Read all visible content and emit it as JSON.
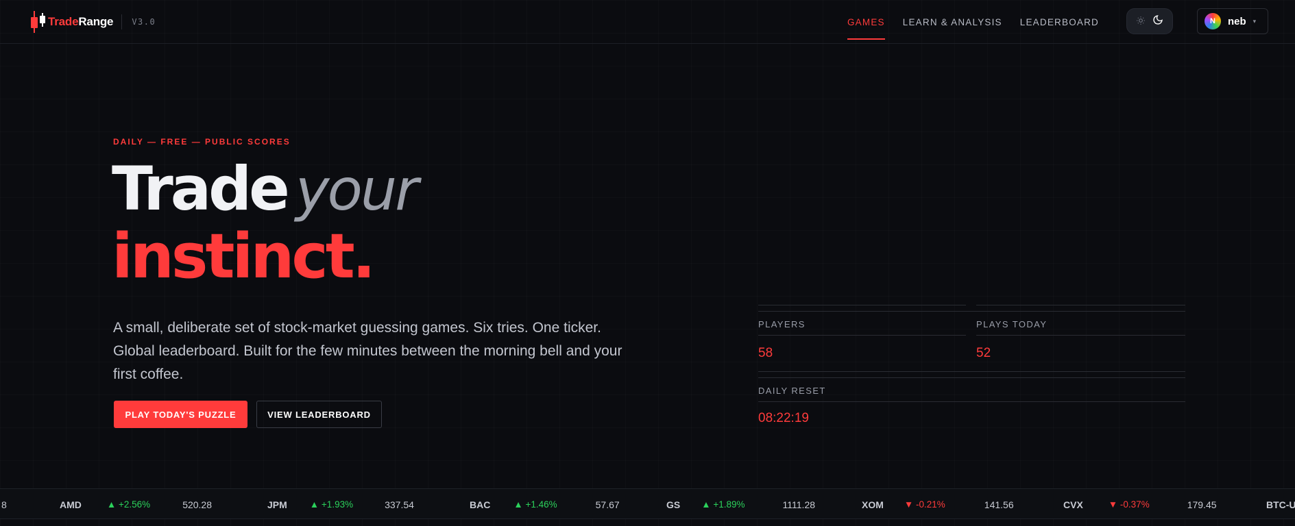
{
  "brand": {
    "name_red": "Trade",
    "name_white": "Range",
    "version": "V3.0"
  },
  "nav": {
    "items": [
      {
        "label": "GAMES",
        "active": true
      },
      {
        "label": "LEARN & ANALYSIS",
        "active": false
      },
      {
        "label": "LEADERBOARD",
        "active": false
      }
    ]
  },
  "user": {
    "name": "neb",
    "avatar_initial": "N"
  },
  "hero": {
    "eyebrow": "DAILY — FREE — PUBLIC SCORES",
    "headline_trade": "Trade",
    "headline_your": "your",
    "headline_instinct": "instinct.",
    "lede": "A small, deliberate set of stock-market guessing games. Six tries. One ticker. Global leaderboard. Built for the few minutes between the morning bell and your first coffee.",
    "primary_cta": "PLAY TODAY'S PUZZLE",
    "secondary_cta": "VIEW LEADERBOARD"
  },
  "stats": {
    "players_label": "PLAYERS",
    "players_value": "58",
    "plays_today_label": "PLAYS TODAY",
    "plays_today_value": "52",
    "daily_reset_label": "DAILY RESET",
    "daily_reset_value": "08:22:19"
  },
  "ticker": [
    {
      "symbol": "",
      "direction": "",
      "change": "",
      "price": "8"
    },
    {
      "symbol": "AMD",
      "direction": "up",
      "change": "+2.56%",
      "price": "520.28"
    },
    {
      "symbol": "JPM",
      "direction": "up",
      "change": "+1.93%",
      "price": "337.54"
    },
    {
      "symbol": "BAC",
      "direction": "up",
      "change": "+1.46%",
      "price": "57.67"
    },
    {
      "symbol": "GS",
      "direction": "up",
      "change": "+1.89%",
      "price": "1111.28"
    },
    {
      "symbol": "XOM",
      "direction": "down",
      "change": "-0.21%",
      "price": "141.56"
    },
    {
      "symbol": "CVX",
      "direction": "down",
      "change": "-0.37%",
      "price": "179.45"
    },
    {
      "symbol": "BTC-U",
      "direction": "",
      "change": "",
      "price": ""
    }
  ],
  "colors": {
    "accent": "#ff3b3b",
    "background": "#0b0c10",
    "up": "#2bd15b",
    "down": "#ff3b3b"
  },
  "icons": {
    "theme_light": "sun-icon",
    "theme_dark": "moon-icon",
    "user_menu": "chevron-down-icon"
  }
}
